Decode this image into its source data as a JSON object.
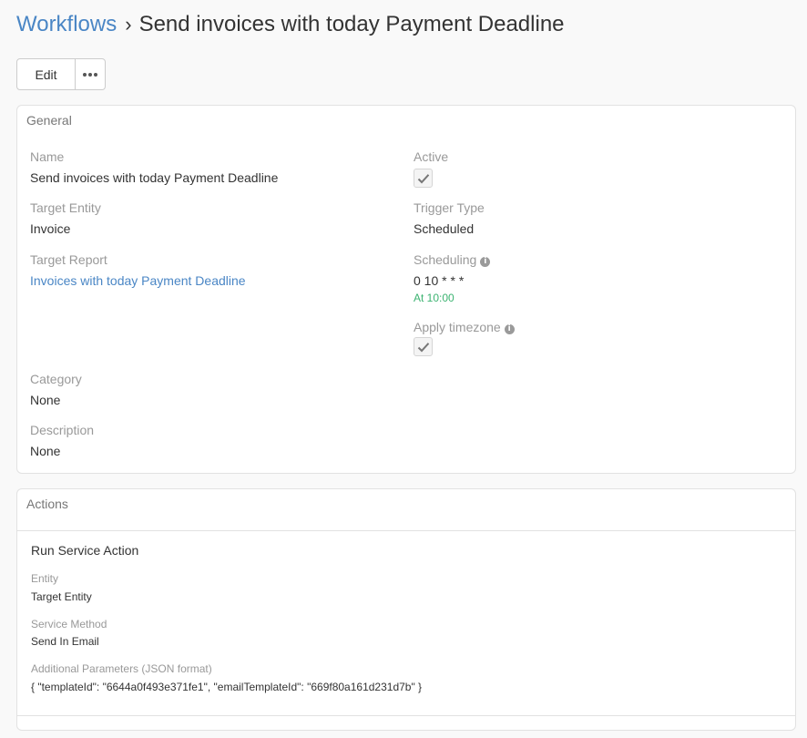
{
  "breadcrumb": {
    "parent": "Workflows",
    "separator": "›",
    "title": "Send invoices with today Payment Deadline"
  },
  "toolbar": {
    "edit_label": "Edit",
    "more_icon": "ellipsis-icon"
  },
  "general": {
    "panel_title": "General",
    "name": {
      "label": "Name",
      "value": "Send invoices with today Payment Deadline"
    },
    "target_entity": {
      "label": "Target Entity",
      "value": "Invoice"
    },
    "target_report": {
      "label": "Target Report",
      "value": "Invoices with today Payment Deadline"
    },
    "category": {
      "label": "Category",
      "value": "None"
    },
    "description": {
      "label": "Description",
      "value": "None"
    },
    "active": {
      "label": "Active",
      "checked": true
    },
    "trigger_type": {
      "label": "Trigger Type",
      "value": "Scheduled"
    },
    "scheduling": {
      "label": "Scheduling",
      "value": "0 10 * * *",
      "hint": "At 10:00"
    },
    "apply_timezone": {
      "label": "Apply timezone",
      "checked": true
    }
  },
  "actions": {
    "panel_title": "Actions",
    "items": [
      {
        "name": "Run Service Action",
        "entity_label": "Entity",
        "entity_value": "Target Entity",
        "method_label": "Service Method",
        "method_value": "Send In Email",
        "params_label": "Additional Parameters (JSON format)",
        "params_value": "{ \"templateId\": \"6644a0f493e371fe1\", \"emailTemplateId\": \"669f80a161d231d7b\" }"
      }
    ]
  },
  "colors": {
    "link": "#4a86c5",
    "hint_green": "#3cb371",
    "label_gray": "#999999"
  }
}
